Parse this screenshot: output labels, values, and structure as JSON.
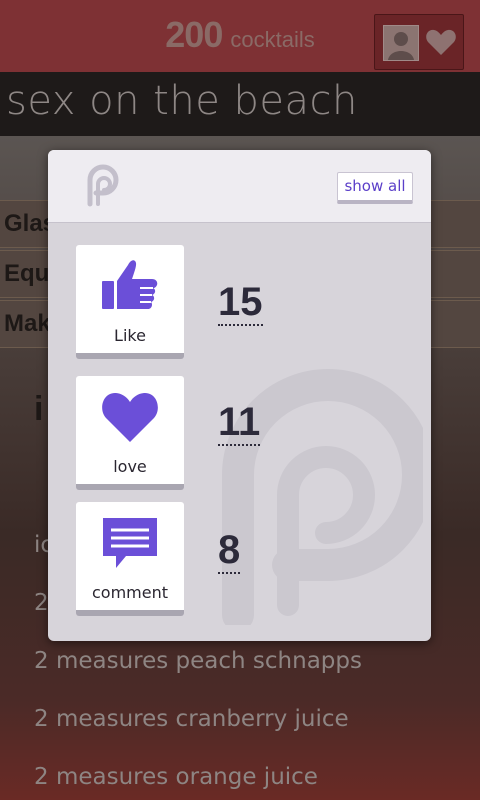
{
  "header": {
    "count": "200",
    "count_unit": "cocktails",
    "icons": [
      "avatar-icon",
      "heart-icon"
    ]
  },
  "drink": {
    "title": "sex on the beach"
  },
  "details": {
    "rows": [
      "Glas",
      "Equ",
      "Mak"
    ],
    "section_heading": "i"
  },
  "ingredients": [
    "ic",
    "2",
    "2 measures peach schnapps",
    "2 measures cranberry juice",
    "2 measures orange juice"
  ],
  "popup": {
    "show_all_label": "show all",
    "reactions": [
      {
        "label": "Like",
        "count": "15",
        "icon": "thumbs-up-icon"
      },
      {
        "label": "love",
        "count": "11",
        "icon": "heart-icon"
      },
      {
        "label": "comment",
        "count": "8",
        "icon": "comment-icon"
      }
    ]
  },
  "colors": {
    "accent": "#6b4fd8",
    "header_bg": "#7e3134",
    "modal_bg": "#d7d4da"
  }
}
